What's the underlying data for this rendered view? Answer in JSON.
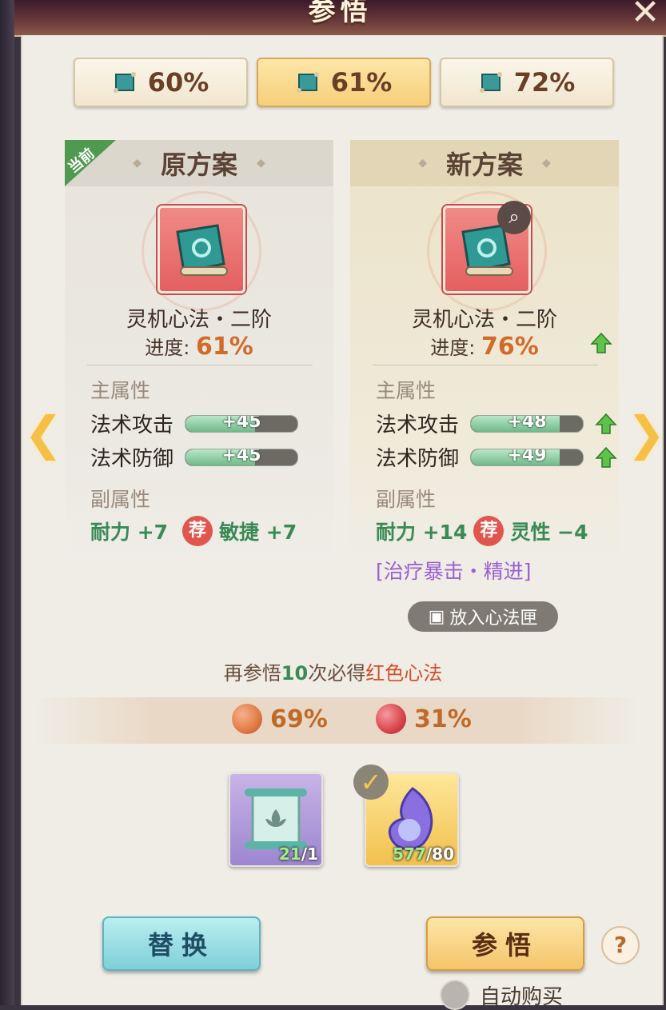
{
  "header": {
    "title": "参悟"
  },
  "tabs": [
    {
      "label": "60%",
      "active": false
    },
    {
      "label": "61%",
      "active": true
    },
    {
      "label": "72%",
      "active": false
    }
  ],
  "old_plan": {
    "tag": "当前",
    "title": "原方案",
    "item_name": "灵机心法・二阶",
    "progress_label": "进度:",
    "progress_value": "61%",
    "main_attr_title": "主属性",
    "main_attrs": [
      {
        "name": "法术攻击",
        "value": "+45",
        "fill": 0.62
      },
      {
        "name": "法术防御",
        "value": "+45",
        "fill": 0.62
      }
    ],
    "sub_attr_title": "副属性",
    "sub_attrs": [
      {
        "text": "耐力 +7"
      },
      {
        "rec": "荐",
        "text": "敏捷 +7"
      }
    ]
  },
  "new_plan": {
    "title": "新方案",
    "item_name": "灵机心法・二阶",
    "progress_label": "进度:",
    "progress_value": "76%",
    "main_attr_title": "主属性",
    "main_attrs": [
      {
        "name": "法术攻击",
        "value": "+48",
        "fill": 0.79
      },
      {
        "name": "法术防御",
        "value": "+49",
        "fill": 0.79
      }
    ],
    "sub_attr_title": "副属性",
    "sub_attrs": [
      {
        "text": "耐力 +14"
      },
      {
        "rec": "荐",
        "text": "灵性 −4"
      }
    ],
    "special_attr": "[治疗暴击・精进]",
    "box_button": "放入心法匣"
  },
  "hint": {
    "pre": "再参悟",
    "num": "10",
    "mid": "次必得",
    "red": "红色心法"
  },
  "probabilities": [
    {
      "value": "69%",
      "color": "#e07a45"
    },
    {
      "value": "31%",
      "color": "#d8444a"
    }
  ],
  "materials": [
    {
      "have": "21",
      "need": "/1"
    },
    {
      "have": "577",
      "need": "/80"
    }
  ],
  "buttons": {
    "replace": "替换",
    "enlighten": "参悟",
    "help": "?"
  },
  "auto_buy": "自动购买",
  "colors": {
    "accent_gold": "#f6cf7a",
    "accent_teal": "#7fcfd8",
    "positive_green": "#3a8a56",
    "special_purple": "#9b5fd4"
  }
}
